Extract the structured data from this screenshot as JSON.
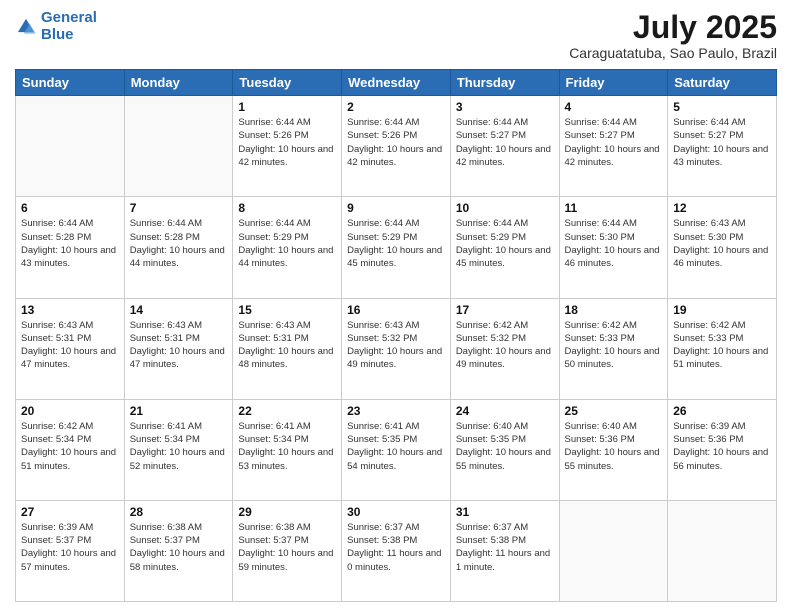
{
  "header": {
    "logo_line1": "General",
    "logo_line2": "Blue",
    "month_title": "July 2025",
    "subtitle": "Caraguatatuba, Sao Paulo, Brazil"
  },
  "days_of_week": [
    "Sunday",
    "Monday",
    "Tuesday",
    "Wednesday",
    "Thursday",
    "Friday",
    "Saturday"
  ],
  "weeks": [
    [
      {
        "day": "",
        "info": ""
      },
      {
        "day": "",
        "info": ""
      },
      {
        "day": "1",
        "info": "Sunrise: 6:44 AM\nSunset: 5:26 PM\nDaylight: 10 hours and 42 minutes."
      },
      {
        "day": "2",
        "info": "Sunrise: 6:44 AM\nSunset: 5:26 PM\nDaylight: 10 hours and 42 minutes."
      },
      {
        "day": "3",
        "info": "Sunrise: 6:44 AM\nSunset: 5:27 PM\nDaylight: 10 hours and 42 minutes."
      },
      {
        "day": "4",
        "info": "Sunrise: 6:44 AM\nSunset: 5:27 PM\nDaylight: 10 hours and 42 minutes."
      },
      {
        "day": "5",
        "info": "Sunrise: 6:44 AM\nSunset: 5:27 PM\nDaylight: 10 hours and 43 minutes."
      }
    ],
    [
      {
        "day": "6",
        "info": "Sunrise: 6:44 AM\nSunset: 5:28 PM\nDaylight: 10 hours and 43 minutes."
      },
      {
        "day": "7",
        "info": "Sunrise: 6:44 AM\nSunset: 5:28 PM\nDaylight: 10 hours and 44 minutes."
      },
      {
        "day": "8",
        "info": "Sunrise: 6:44 AM\nSunset: 5:29 PM\nDaylight: 10 hours and 44 minutes."
      },
      {
        "day": "9",
        "info": "Sunrise: 6:44 AM\nSunset: 5:29 PM\nDaylight: 10 hours and 45 minutes."
      },
      {
        "day": "10",
        "info": "Sunrise: 6:44 AM\nSunset: 5:29 PM\nDaylight: 10 hours and 45 minutes."
      },
      {
        "day": "11",
        "info": "Sunrise: 6:44 AM\nSunset: 5:30 PM\nDaylight: 10 hours and 46 minutes."
      },
      {
        "day": "12",
        "info": "Sunrise: 6:43 AM\nSunset: 5:30 PM\nDaylight: 10 hours and 46 minutes."
      }
    ],
    [
      {
        "day": "13",
        "info": "Sunrise: 6:43 AM\nSunset: 5:31 PM\nDaylight: 10 hours and 47 minutes."
      },
      {
        "day": "14",
        "info": "Sunrise: 6:43 AM\nSunset: 5:31 PM\nDaylight: 10 hours and 47 minutes."
      },
      {
        "day": "15",
        "info": "Sunrise: 6:43 AM\nSunset: 5:31 PM\nDaylight: 10 hours and 48 minutes."
      },
      {
        "day": "16",
        "info": "Sunrise: 6:43 AM\nSunset: 5:32 PM\nDaylight: 10 hours and 49 minutes."
      },
      {
        "day": "17",
        "info": "Sunrise: 6:42 AM\nSunset: 5:32 PM\nDaylight: 10 hours and 49 minutes."
      },
      {
        "day": "18",
        "info": "Sunrise: 6:42 AM\nSunset: 5:33 PM\nDaylight: 10 hours and 50 minutes."
      },
      {
        "day": "19",
        "info": "Sunrise: 6:42 AM\nSunset: 5:33 PM\nDaylight: 10 hours and 51 minutes."
      }
    ],
    [
      {
        "day": "20",
        "info": "Sunrise: 6:42 AM\nSunset: 5:34 PM\nDaylight: 10 hours and 51 minutes."
      },
      {
        "day": "21",
        "info": "Sunrise: 6:41 AM\nSunset: 5:34 PM\nDaylight: 10 hours and 52 minutes."
      },
      {
        "day": "22",
        "info": "Sunrise: 6:41 AM\nSunset: 5:34 PM\nDaylight: 10 hours and 53 minutes."
      },
      {
        "day": "23",
        "info": "Sunrise: 6:41 AM\nSunset: 5:35 PM\nDaylight: 10 hours and 54 minutes."
      },
      {
        "day": "24",
        "info": "Sunrise: 6:40 AM\nSunset: 5:35 PM\nDaylight: 10 hours and 55 minutes."
      },
      {
        "day": "25",
        "info": "Sunrise: 6:40 AM\nSunset: 5:36 PM\nDaylight: 10 hours and 55 minutes."
      },
      {
        "day": "26",
        "info": "Sunrise: 6:39 AM\nSunset: 5:36 PM\nDaylight: 10 hours and 56 minutes."
      }
    ],
    [
      {
        "day": "27",
        "info": "Sunrise: 6:39 AM\nSunset: 5:37 PM\nDaylight: 10 hours and 57 minutes."
      },
      {
        "day": "28",
        "info": "Sunrise: 6:38 AM\nSunset: 5:37 PM\nDaylight: 10 hours and 58 minutes."
      },
      {
        "day": "29",
        "info": "Sunrise: 6:38 AM\nSunset: 5:37 PM\nDaylight: 10 hours and 59 minutes."
      },
      {
        "day": "30",
        "info": "Sunrise: 6:37 AM\nSunset: 5:38 PM\nDaylight: 11 hours and 0 minutes."
      },
      {
        "day": "31",
        "info": "Sunrise: 6:37 AM\nSunset: 5:38 PM\nDaylight: 11 hours and 1 minute."
      },
      {
        "day": "",
        "info": ""
      },
      {
        "day": "",
        "info": ""
      }
    ]
  ]
}
